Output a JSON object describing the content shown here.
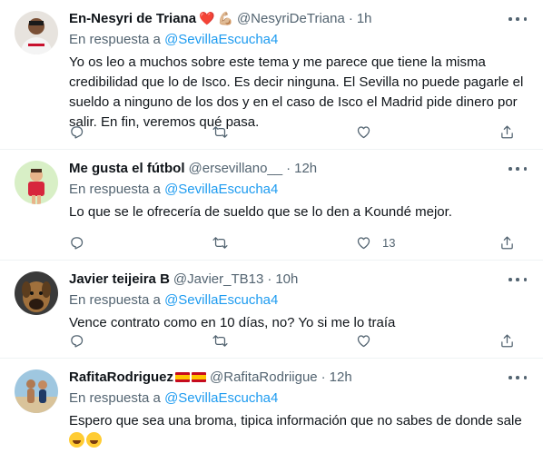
{
  "tweets": [
    {
      "name": "En-Nesyri de Triana",
      "emojis": [
        "❤️",
        "💪🏼"
      ],
      "handle": "@NesyriDeTriana",
      "separator": "·",
      "time": "1h",
      "reply_prefix": "En respuesta a",
      "reply_mention": "@SevillaEscucha4",
      "text": "Yo os leo a muchos sobre este tema y me parece que tiene la misma credibilidad que lo de Isco. Es decir ninguna. El Sevilla no puede pagarle el sueldo a ninguno de los dos y en el caso de Isco el Madrid pide dinero por salir. En fin, veremos qué pasa.",
      "like_count": ""
    },
    {
      "name": "Me gusta el fútbol",
      "handle": "@ersevillano__",
      "separator": "·",
      "time": "12h",
      "reply_prefix": "En respuesta a",
      "reply_mention": "@SevillaEscucha4",
      "text": "Lo que se le ofrecería de sueldo que se lo den a Koundé mejor.",
      "like_count": "13"
    },
    {
      "name": "Javier teijeira B",
      "handle": "@Javier_TB13",
      "separator": "·",
      "time": "10h",
      "reply_prefix": "En respuesta a",
      "reply_mention": "@SevillaEscucha4",
      "text": "Vence contrato como en 10 días, no? Yo si me lo traía",
      "like_count": ""
    },
    {
      "name": "RafitaRodriguez",
      "handle": "@RafitaRodriigue",
      "separator": "·",
      "time": "12h",
      "reply_prefix": "En respuesta a",
      "reply_mention": "@SevillaEscucha4",
      "text": "Espero que sea una broma, tipica información que no sabes de donde sale",
      "like_count": ""
    }
  ],
  "icons": {
    "reply": "reply-icon",
    "retweet": "retweet-icon",
    "like": "heart-icon",
    "share": "share-icon",
    "more": "more-icon"
  },
  "colors": {
    "link": "#1d9bf0",
    "secondary_text": "#536471",
    "primary_text": "#0f1419",
    "divider": "#eff3f4"
  }
}
